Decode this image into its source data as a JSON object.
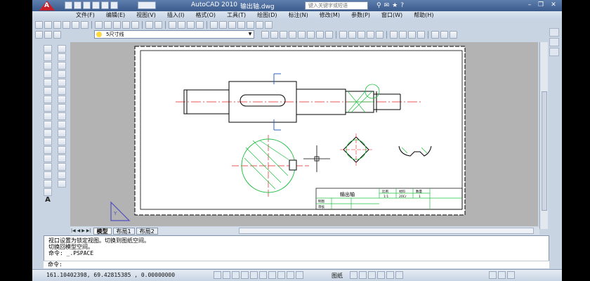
{
  "app": {
    "title": "AutoCAD 2010",
    "document": "输出轴.dwg"
  },
  "search": {
    "placeholder": "键入关键字或短语"
  },
  "menu": [
    "文件(F)",
    "编辑(E)",
    "视图(V)",
    "插入(I)",
    "格式(O)",
    "工具(T)",
    "绘图(D)",
    "标注(N)",
    "修改(M)",
    "参数(P)",
    "窗口(W)",
    "帮助(H)"
  ],
  "layer": {
    "current": "5尺寸线"
  },
  "tabs": [
    {
      "label": "模型",
      "active": true
    },
    {
      "label": "布局1",
      "active": false
    },
    {
      "label": "布局2",
      "active": false
    }
  ],
  "command": {
    "history": [
      "视口设置为锁定视图。切换到图纸空间。",
      "切换回模型空间。",
      "命令: _.PSPACE"
    ],
    "prompt": "命令:"
  },
  "status": {
    "coords": "161.10402398, 69.42815385 , 0.00000000",
    "paper": "图纸"
  },
  "drawing": {
    "title_block": {
      "part_name": "输出轴",
      "col1": "比例",
      "col2": "材料",
      "col3": "数量",
      "val1": "1:1",
      "val2": "20Cr",
      "val3": "1",
      "row1": "制图",
      "row2": "审核"
    }
  },
  "colors": {
    "accent": "#3a5a8c",
    "red_line": "#e02020",
    "green_line": "#20c040"
  }
}
